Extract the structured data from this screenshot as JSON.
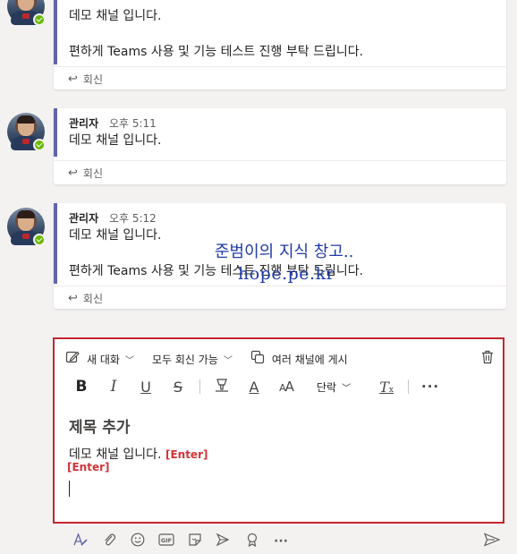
{
  "posts": [
    {
      "author": "",
      "time": "",
      "lines": [
        "데모 채널 입니다.",
        "",
        "편하게 Teams 사용 및 기능 테스트 진행 부탁 드립니다."
      ],
      "reply_label": "회신"
    },
    {
      "author": "관리자",
      "time": "오후 5:11",
      "lines": [
        "데모 채널 입니다."
      ],
      "reply_label": "회신"
    },
    {
      "author": "관리자",
      "time": "오후 5:12",
      "lines": [
        "데모 채널 입니다.",
        "",
        "편하게 Teams 사용 및 기능 테스트 진행 부탁 드립니다."
      ],
      "reply_label": "회신"
    }
  ],
  "watermark": {
    "line1": "준범이의 지식 창고..",
    "line2": "hope.pe.kr"
  },
  "compose": {
    "new_conversation": "새 대화",
    "reply_all": "모두 회신 가능",
    "post_multiple": "여러 채널에 게시",
    "paragraph": "단락",
    "subject": "제목 추가",
    "body": "데모 채널 입니다.",
    "enter_label": "[Enter]"
  },
  "icons": {
    "format": [
      "bold-icon",
      "italic-icon",
      "underline-icon",
      "strikethrough-icon",
      "highlight-icon",
      "font-color-icon",
      "font-size-icon",
      "clear-formatting-icon",
      "more-options-icon"
    ],
    "bottom": [
      "format-icon",
      "attach-icon",
      "emoji-icon",
      "gif-icon",
      "sticker-icon",
      "meet-now-icon",
      "praise-icon",
      "more-icon",
      "send-icon"
    ]
  },
  "colors": {
    "accent": "#6264a7",
    "highlight_border": "#c4262e",
    "enter_red": "#d13438",
    "presence": "#6bb700"
  }
}
